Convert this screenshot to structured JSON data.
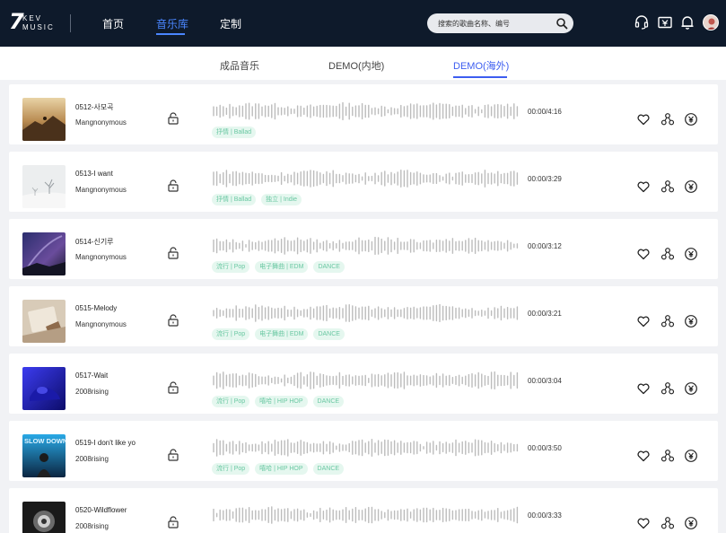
{
  "header": {
    "logo_main": "7",
    "logo_line1": "KEV",
    "logo_line2": "MUSIC",
    "nav": [
      "首页",
      "音乐库",
      "定制"
    ],
    "search_placeholder": "搜索的歌曲名称、编号",
    "icons": [
      "search-icon",
      "headset-icon",
      "ticket-icon",
      "bell-icon",
      "avatar"
    ],
    "accent_color": "#4a86ff",
    "bar_color": "#0e1a2b"
  },
  "subtabs": [
    "成品音乐",
    "DEMO(内地)",
    "DEMO(海外)"
  ],
  "active_subtab": "DEMO(海外)",
  "tracks": [
    {
      "title": "0512-사모곡",
      "artist": "Mangnonymous",
      "time": "00:00/4:16",
      "tags": [
        "抒情 | Ballad"
      ]
    },
    {
      "title": "0513-I want",
      "artist": "Mangnonymous",
      "time": "00:00/3:29",
      "tags": [
        "抒情 | Ballad",
        "独立 | Indie"
      ]
    },
    {
      "title": "0514-신기루",
      "artist": "Mangnonymous",
      "time": "00:00/3:12",
      "tags": [
        "流行 | Pop",
        "电子舞曲 | EDM",
        "DANCE"
      ]
    },
    {
      "title": "0515-Melody",
      "artist": "Mangnonymous",
      "time": "00:00/3:21",
      "tags": [
        "流行 | Pop",
        "电子舞曲 | EDM",
        "DANCE"
      ]
    },
    {
      "title": "0517-Wait",
      "artist": "2008rising",
      "time": "00:00/3:04",
      "tags": [
        "流行 | Pop",
        "嘻哈 | HIP HOP",
        "DANCE"
      ]
    },
    {
      "title": "0519-I don't like yo",
      "artist": "2008rising",
      "time": "00:00/3:50",
      "tags": [
        "流行 | Pop",
        "嘻哈 | HIP HOP",
        "DANCE"
      ],
      "cover_text": "SLOW DOWN"
    },
    {
      "title": "0520-Wildflower",
      "artist": "2008rising",
      "time": "00:00/3:33",
      "tags": []
    }
  ],
  "row_actions": [
    "heart-icon",
    "share-icon",
    "yuan-icon"
  ],
  "tag_colors": {
    "bg": "#e5f7ef",
    "text": "#6bc8a3"
  }
}
